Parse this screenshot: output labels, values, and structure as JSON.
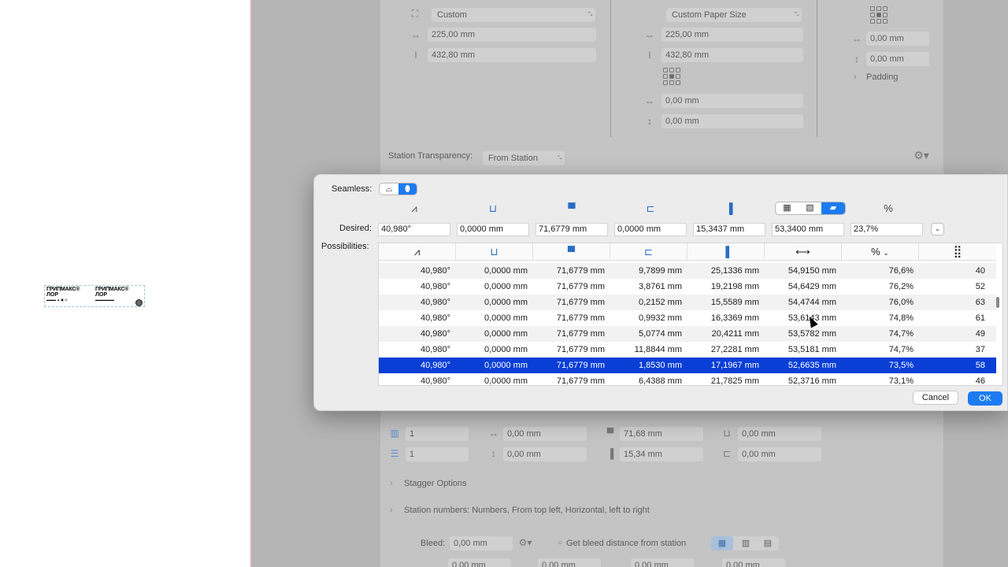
{
  "preview_label": {
    "brand_line_1": "ГРИПМАКС®",
    "brand_line_2": "ЛОР",
    "brand_line_3": "ГРИПМАКС®",
    "brand_line_4": "ЛОР"
  },
  "background": {
    "left_size_select": "Custom",
    "left_width": "225,00 mm",
    "left_height": "432,80 mm",
    "paper_size_select": "Custom Paper Size",
    "paper_width": "225,00 mm",
    "paper_height": "432,80 mm",
    "offset_x": "0,00 mm",
    "offset_y": "0,00 mm",
    "right_x": "0,00 mm",
    "right_y": "0,00 mm",
    "padding_label": "Padding",
    "station_transparency_label": "Station Transparency:",
    "station_transparency_value": "From Station",
    "cols_value": "1",
    "rows_value": "1",
    "gap_h": "0,00 mm",
    "gap_v": "0,00 mm",
    "width_value": "71,68 mm",
    "height_value": "15,34 mm",
    "margin_h": "0,00 mm",
    "margin_v": "0,00 mm",
    "stagger_options": "Stagger Options",
    "station_numbers": "Station numbers: Numbers, From top left, Horizontal, left to right",
    "bleed_label": "Bleed:",
    "bleed_value": "0,00 mm",
    "bleed_checkbox_label": "Get bleed distance from station",
    "bottom_values": [
      "0,00 mm",
      "0,00 mm",
      "0,00 mm",
      "0,00 mm"
    ]
  },
  "dialog": {
    "seamless_label": "Seamless:",
    "desired_label": "Desired:",
    "possibilities_label": "Possibilities:",
    "desired": [
      "40,980°",
      "0,0000 mm",
      "71,6779 mm",
      "0,0000 mm",
      "15,3437 mm",
      "53,3400 mm",
      "23,7%"
    ],
    "cancel_label": "Cancel",
    "ok_label": "OK",
    "selected_row_index": 6,
    "rows": [
      [
        "40,980°",
        "0,0000 mm",
        "71,6779 mm",
        "9,7899 mm",
        "25,1336 mm",
        "54,9150 mm",
        "76,6%",
        "40"
      ],
      [
        "40,980°",
        "0,0000 mm",
        "71,6779 mm",
        "3,8761 mm",
        "19,2198 mm",
        "54,6429 mm",
        "76,2%",
        "52"
      ],
      [
        "40,980°",
        "0,0000 mm",
        "71,6779 mm",
        "0,2152 mm",
        "15,5589 mm",
        "54,4744 mm",
        "76,0%",
        "63"
      ],
      [
        "40,980°",
        "0,0000 mm",
        "71,6779 mm",
        "0,9932 mm",
        "16,3369 mm",
        "53,6143 mm",
        "74,8%",
        "61"
      ],
      [
        "40,980°",
        "0,0000 mm",
        "71,6779 mm",
        "5,0774 mm",
        "20,4211 mm",
        "53,5782 mm",
        "74,7%",
        "49"
      ],
      [
        "40,980°",
        "0,0000 mm",
        "71,6779 mm",
        "11,8844 mm",
        "27,2281 mm",
        "53,5181 mm",
        "74,7%",
        "37"
      ],
      [
        "40,980°",
        "0,0000 mm",
        "71,6779 mm",
        "1,8530 mm",
        "17,1967 mm",
        "52,6635 mm",
        "73,5%",
        "58"
      ],
      [
        "40,980°",
        "0,0000 mm",
        "71,6779 mm",
        "6,4388 mm",
        "21,7825 mm",
        "52,3716 mm",
        "73,1%",
        "46"
      ]
    ]
  },
  "icons": {
    "angle": "angle-icon",
    "step": "step-icon",
    "repeat": "repeat-icon",
    "gap": "gap-icon",
    "height": "height-icon",
    "width": "width-arrow-icon",
    "percent": "percent-icon",
    "count": "grid-count-icon"
  },
  "colors": {
    "accent": "#1d7bf1",
    "selection": "#0a3fd6",
    "icon_blue": "#2a6cc4"
  }
}
